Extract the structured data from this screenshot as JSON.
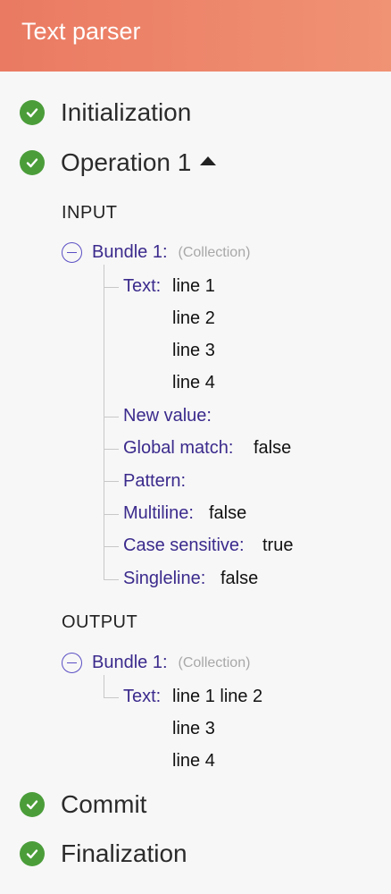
{
  "header": {
    "title": "Text parser"
  },
  "steps": {
    "initialization": "Initialization",
    "operation": "Operation 1",
    "commit": "Commit",
    "finalization": "Finalization"
  },
  "input": {
    "label": "INPUT",
    "bundle": {
      "name": "Bundle 1:",
      "type": "(Collection)"
    },
    "fields": {
      "text": {
        "key": "Text:",
        "lines": [
          "line 1",
          "line 2",
          "line 3",
          "line 4"
        ]
      },
      "new_value": {
        "key": "New value:",
        "value": ""
      },
      "global_match": {
        "key": "Global match:",
        "value": "false"
      },
      "pattern": {
        "key": "Pattern:",
        "value": ""
      },
      "multiline": {
        "key": "Multiline:",
        "value": "false"
      },
      "case_sensitive": {
        "key": "Case sensitive:",
        "value": "true"
      },
      "singleline": {
        "key": "Singleline:",
        "value": "false"
      }
    }
  },
  "output": {
    "label": "OUTPUT",
    "bundle": {
      "name": "Bundle 1:",
      "type": "(Collection)"
    },
    "fields": {
      "text": {
        "key": "Text:",
        "lines": [
          "line 1 line 2",
          "line 3",
          "line 4"
        ]
      }
    }
  },
  "colors": {
    "header_start": "#ea7a62",
    "header_end": "#f09274",
    "success": "#4b9d3a",
    "key": "#3b2a8c",
    "toggle": "#5b4fc4"
  },
  "icons": {
    "step_status": "check-circle-icon",
    "expand": "caret-up-icon",
    "collapse": "minus-circle-icon"
  }
}
